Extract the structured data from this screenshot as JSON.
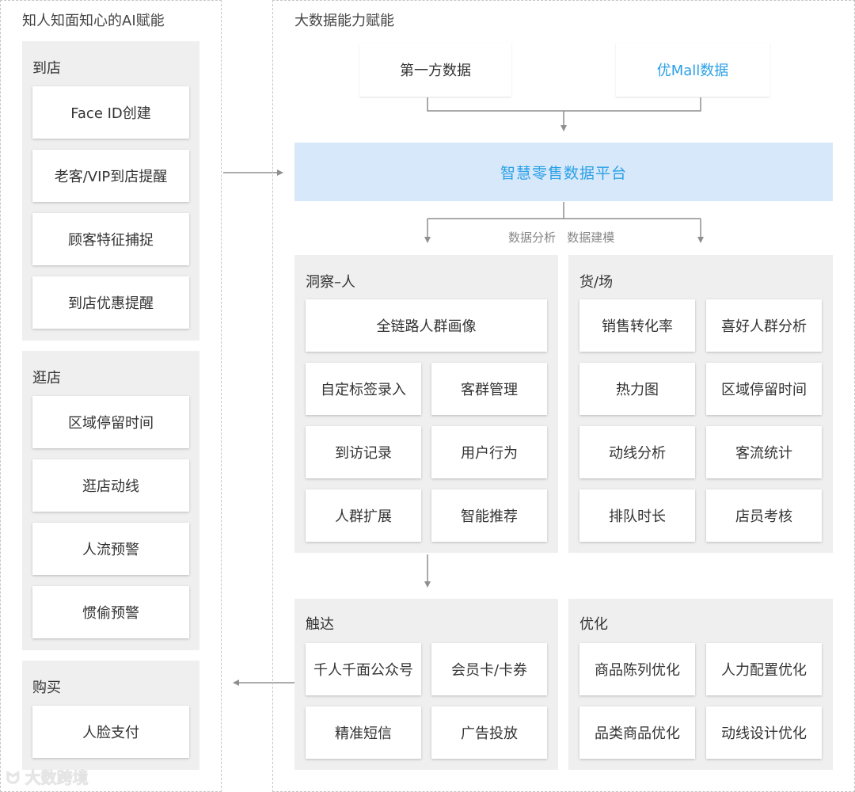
{
  "left_panel": {
    "title": "知人知面知心的AI赋能",
    "groups": [
      {
        "label": "到店",
        "items": [
          "Face ID创建",
          "老客/VIP到店提醒",
          "顾客特征捕捉",
          "到店优惠提醒"
        ]
      },
      {
        "label": "逛店",
        "items": [
          "区域停留时间",
          "逛店动线",
          "人流预警",
          "惯偷预警"
        ]
      },
      {
        "label": "购买",
        "items": [
          "人脸支付"
        ]
      }
    ]
  },
  "right_panel": {
    "title": "大数据能力赋能",
    "sources": [
      {
        "label": "第一方数据",
        "color": "#333333"
      },
      {
        "label": "优Mall数据",
        "color": "#2aa0e6"
      }
    ],
    "platform": "智慧零售数据平台",
    "analysis_note": "数据分析   数据建模",
    "insight": {
      "label": "洞察–人",
      "top_item": "全链路人群画像",
      "grid": [
        "自定标签录入",
        "客群管理",
        "到访记录",
        "用户行为",
        "人群扩展",
        "智能推荐"
      ]
    },
    "goods": {
      "label": "货/场",
      "grid": [
        "销售转化率",
        "喜好人群分析",
        "热力图",
        "区域停留时间",
        "动线分析",
        "客流统计",
        "排队时长",
        "店员考核"
      ]
    },
    "reach": {
      "label": "触达",
      "grid": [
        "千人千面公众号",
        "会员卡/卡券",
        "精准短信",
        "广告投放"
      ]
    },
    "optimize": {
      "label": "优化",
      "grid": [
        "商品陈列优化",
        "人力配置优化",
        "品类商品优化",
        "动线设计优化"
      ]
    }
  },
  "watermark": "大数跨境",
  "colors": {
    "accent": "#2aa0e6",
    "platform_bg": "#d7e8fa",
    "group_bg": "#efefef",
    "line": "#8f8f8f"
  }
}
